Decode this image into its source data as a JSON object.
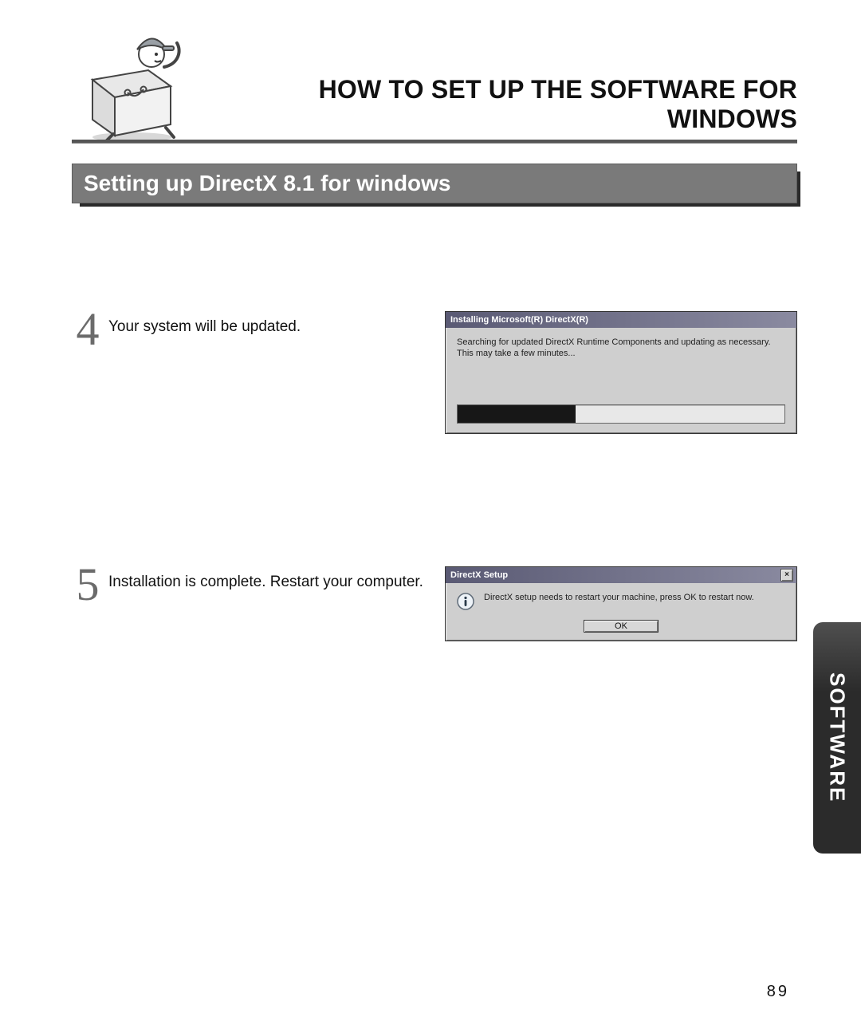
{
  "header": {
    "title": "HOW TO SET UP THE SOFTWARE FOR WINDOWS"
  },
  "section": {
    "title": "Setting up DirectX 8.1 for windows"
  },
  "steps": {
    "s4": {
      "num": "4",
      "text": "Your system will be updated.",
      "dialog": {
        "title": "Installing Microsoft(R) DirectX(R)",
        "message": "Searching for updated DirectX Runtime Components and updating as necessary. This may take a few minutes..."
      }
    },
    "s5": {
      "num": "5",
      "text": "Installation is complete. Restart your computer.",
      "dialog": {
        "title": "DirectX Setup",
        "message": "DirectX setup needs to restart your machine, press OK to restart now.",
        "ok": "OK",
        "close": "×"
      }
    }
  },
  "side_tab": "SOFTWARE",
  "page_number": "89"
}
